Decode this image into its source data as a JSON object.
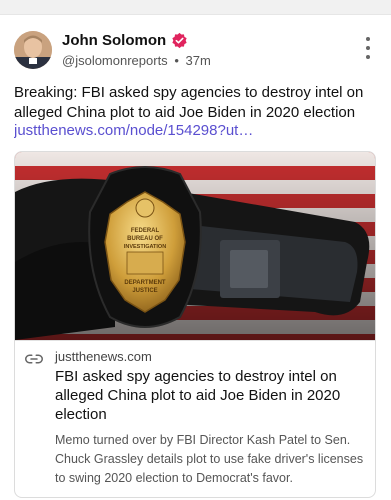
{
  "author": {
    "name": "John Solomon",
    "handle": "@jsolomonreports",
    "separator": "•",
    "time": "37m"
  },
  "post": {
    "text": "Breaking: FBI asked spy agencies to destroy intel on alleged China plot to aid Joe Biden in 2020 election",
    "link_text": "justthenews.com/node/154298?ut…"
  },
  "card": {
    "domain": "justthenews.com",
    "title": "FBI asked spy agencies to destroy intel on alleged China plot to aid Joe Biden in 2020 election",
    "description": "Memo turned over by FBI Director Kash Patel to Sen. Chuck Grassley details plot to use fake driver's licenses to swing 2020 election to Democrat's favor."
  },
  "badge_text": {
    "line1": "FEDERAL",
    "line2": "BUREAU OF",
    "line3": "INVESTIGATION",
    "line4": "DEPARTMENT",
    "line5": "JUSTICE"
  },
  "icons": {
    "verified": "verified-badge-icon",
    "more": "more-vertical-icon",
    "link": "link-icon"
  },
  "colors": {
    "accent": "#e0245e",
    "link": "#5a4fd0"
  }
}
